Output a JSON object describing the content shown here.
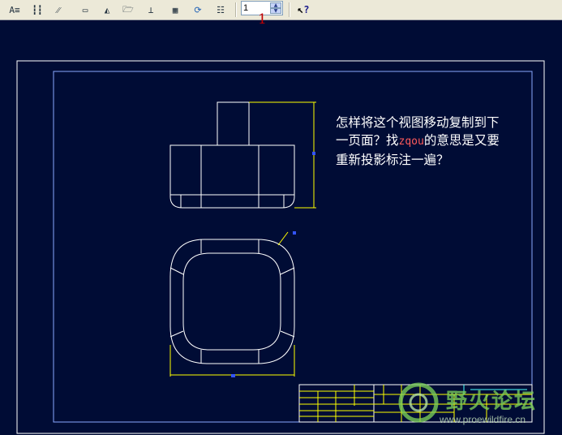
{
  "toolbar": {
    "buttons": [
      {
        "name": "text-style-icon",
        "glyph": "A≡"
      },
      {
        "name": "dimension-icon",
        "glyph": "┇┇"
      },
      {
        "name": "tolerance-icon",
        "glyph": "⁄⁄"
      },
      {
        "name": "block-icon",
        "glyph": "▭"
      },
      {
        "name": "view-icon",
        "glyph": "◭"
      },
      {
        "name": "open-folder-icon",
        "glyph": "🗁"
      },
      {
        "name": "insert-icon",
        "glyph": "⊥"
      },
      {
        "name": "table-icon",
        "glyph": "▦"
      },
      {
        "name": "refresh-icon",
        "glyph": "⟳"
      },
      {
        "name": "list-icon",
        "glyph": "☷"
      }
    ],
    "page_value": "1",
    "help_glyph": "?"
  },
  "annotation_number": "1",
  "note": {
    "before": "怎样将这个视图移动复制到下一页面？找",
    "highlight": "zqou",
    "after": "的意思是又要重新投影标注一遍？"
  },
  "watermark": {
    "title": "野火论坛",
    "url": "www.proewildfire.cn"
  },
  "colors": {
    "background": "#000c35",
    "drawing_lines": "#ffffff",
    "dimension_lines": "#ffff00",
    "inner_border": "#8aa8ff",
    "highlight_text": "#ff5a5a"
  }
}
